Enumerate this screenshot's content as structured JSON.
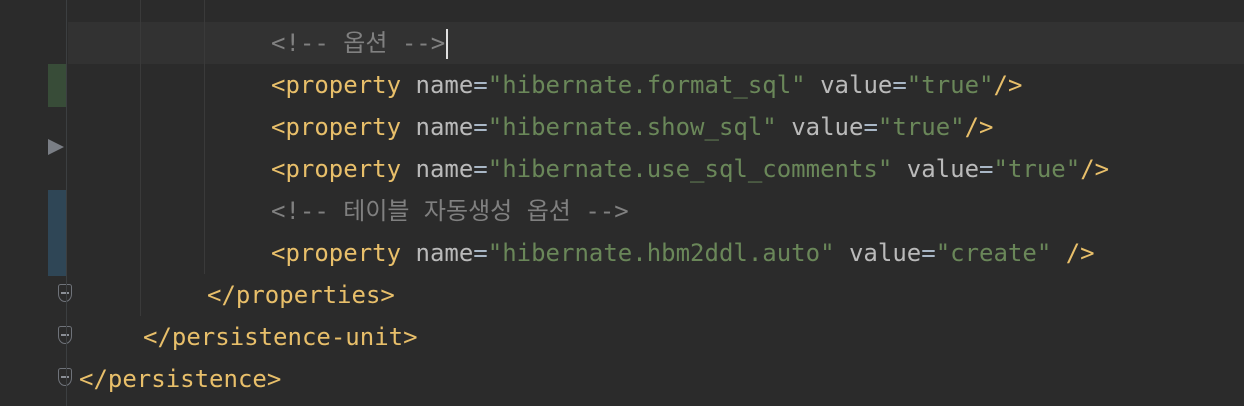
{
  "lines": [
    {
      "type": "comment",
      "text": "<!-- 옵션 -->"
    },
    {
      "type": "property",
      "open": "<property",
      "name_attr": "name",
      "name_val": "\"hibernate.format_sql\"",
      "value_attr": "value",
      "value_val": "\"true\"",
      "close": "/>"
    },
    {
      "type": "property",
      "open": "<property",
      "name_attr": "name",
      "name_val": "\"hibernate.show_sql\"",
      "value_attr": "value",
      "value_val": "\"true\"",
      "close": "/>"
    },
    {
      "type": "property",
      "open": "<property",
      "name_attr": "name",
      "name_val": "\"hibernate.use_sql_comments\"",
      "value_attr": "value",
      "value_val": "\"true\"",
      "close": "/>"
    },
    {
      "type": "comment",
      "text": "<!-- 테이블 자동생성 옵션 -->"
    },
    {
      "type": "property",
      "open": "<property",
      "name_attr": "name",
      "name_val": "\"hibernate.hbm2ddl.auto\"",
      "value_attr": "value",
      "value_val": "\"create\"",
      "close": " />"
    },
    {
      "type": "tag",
      "text": "</properties>"
    },
    {
      "type": "tag",
      "text": "</persistence-unit>"
    },
    {
      "type": "tag",
      "text": "</persistence>"
    }
  ],
  "icons": {
    "bulb": "lightbulb-icon",
    "fold": "fold-collapse-icon",
    "run_arrow": "run-gutter-icon"
  },
  "colors": {
    "background": "#2b2b2b",
    "tag": "#e8bf6a",
    "attribute": "#bababa",
    "string": "#6a8759",
    "comment": "#808080",
    "bulb": "#f0b429"
  }
}
